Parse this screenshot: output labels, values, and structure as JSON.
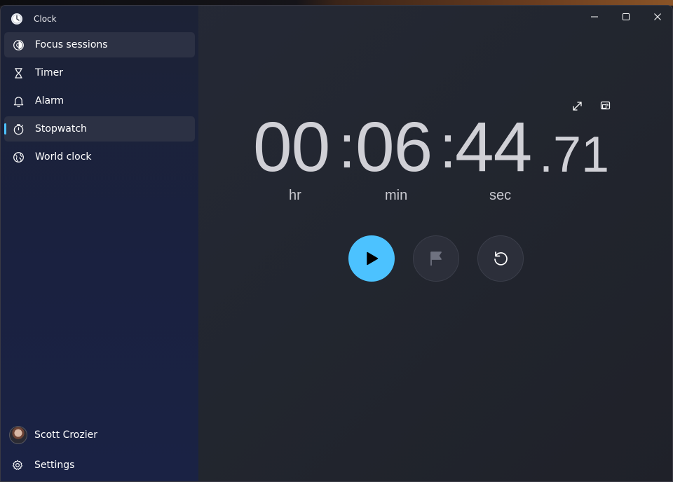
{
  "window": {
    "title": "Clock"
  },
  "nav": {
    "items": [
      {
        "label": "Focus sessions",
        "icon": "focus-icon"
      },
      {
        "label": "Timer",
        "icon": "hourglass-icon"
      },
      {
        "label": "Alarm",
        "icon": "bell-icon"
      },
      {
        "label": "Stopwatch",
        "icon": "stopwatch-icon"
      },
      {
        "label": "World clock",
        "icon": "globe-icon"
      }
    ],
    "selected": "Stopwatch",
    "hovered": "Focus sessions"
  },
  "account": {
    "name": "Scott Crozier"
  },
  "settings": {
    "label": "Settings"
  },
  "stopwatch": {
    "hours": "00",
    "minutes": "06",
    "seconds": "44",
    "hundredths": ".71",
    "units": {
      "hours": "hr",
      "minutes": "min",
      "seconds": "sec"
    }
  },
  "colors": {
    "accent": "#4cc2ff",
    "digits": "#d0d0d6"
  }
}
